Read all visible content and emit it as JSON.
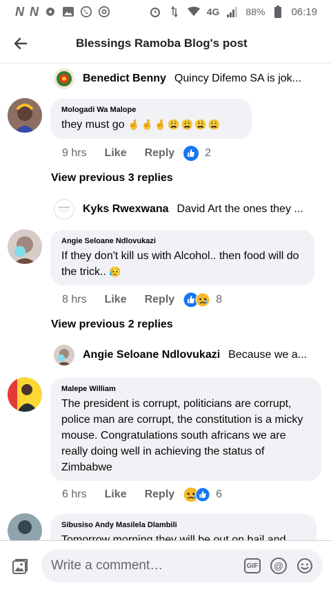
{
  "statusbar": {
    "left_glyphs": [
      "N",
      "N"
    ],
    "network": "4G",
    "battery": "88%",
    "time": "06:19"
  },
  "header": {
    "title": "Blessings Ramoba Blog's post"
  },
  "comments": [
    {
      "reply_preview": {
        "name": "Benedict Benny",
        "text": "Quincy Difemo SA is jok..."
      }
    },
    {
      "name": "Mologadi Wa Malope",
      "text": "they  must go",
      "emoji": "🤞🤞🤞😩😩😩😩",
      "time": "9 hrs",
      "like": "Like",
      "reply": "Reply",
      "reaction_count": "2",
      "view_previous": "View previous 3 replies",
      "reply_preview": {
        "name": "Kyks Rwexwana",
        "text": "David Art the ones they ..."
      }
    },
    {
      "name": "Angie Seloane Ndlovukazi",
      "text": "If they don't kill us with Alcohol.. then food will do the trick..",
      "emoji": "😥",
      "time": "8 hrs",
      "like": "Like",
      "reply": "Reply",
      "reaction_count": "8",
      "view_previous": "View previous 2 replies",
      "reply_preview": {
        "name": "Angie Seloane Ndlovukazi",
        "text": "Because we a..."
      }
    },
    {
      "name": "Malepe William",
      "text": "The president is corrupt, politicians are corrupt, police man are corrupt, the constitution is a micky mouse. Congratulations south africans we are really doing well in achieving the status of Zimbabwe",
      "time": "6 hrs",
      "like": "Like",
      "reply": "Reply",
      "reaction_count": "6"
    },
    {
      "name": "Sibusiso Andy Masilela Dlambili",
      "text": "Tomorrow morning they will be out on bail and"
    }
  ],
  "composer": {
    "placeholder": "Write a comment…",
    "gif_label": "GIF",
    "at_label": "@"
  },
  "colors": {
    "like_blue": "#1877f2",
    "bubble_bg": "#f0f2f5",
    "muted_text": "#65676b"
  }
}
